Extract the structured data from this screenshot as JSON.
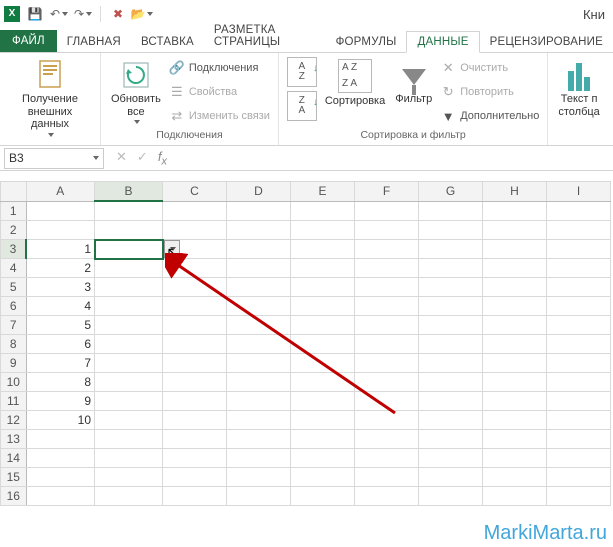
{
  "qat": {
    "book_title": "Кни",
    "icons": {
      "save": "💾",
      "undo": "↶",
      "redo": "↷",
      "remove": "✖",
      "open": "📂"
    }
  },
  "tabs": {
    "file": "ФАЙЛ",
    "home": "ГЛАВНАЯ",
    "insert": "ВСТАВКА",
    "page_layout": "РАЗМЕТКА СТРАНИЦЫ",
    "formulas": "ФОРМУЛЫ",
    "data": "ДАННЫЕ",
    "review": "РЕЦЕНЗИРОВАНИЕ"
  },
  "ribbon": {
    "get_data": {
      "label": "Получение\nвнешних данных"
    },
    "connections": {
      "refresh": "Обновить\nвсе",
      "conn": "Подключения",
      "props": "Свойства",
      "edit_links": "Изменить связи",
      "group_label": "Подключения"
    },
    "sort_filter": {
      "sort": "Сортировка",
      "filter": "Фильтр",
      "clear": "Очистить",
      "reapply": "Повторить",
      "advanced": "Дополнительно",
      "group_label": "Сортировка и фильтр"
    },
    "text": {
      "text_to_cols": "Текст п\nстолбца"
    }
  },
  "name_box": "B3",
  "columns": [
    "A",
    "B",
    "C",
    "D",
    "E",
    "F",
    "G",
    "H",
    "I"
  ],
  "rows": [
    "1",
    "2",
    "3",
    "4",
    "5",
    "6",
    "7",
    "8",
    "9",
    "10",
    "11",
    "12",
    "13",
    "14",
    "15",
    "16"
  ],
  "cell_values": {
    "A3": "1",
    "A4": "2",
    "A5": "3",
    "A6": "4",
    "A7": "5",
    "A8": "6",
    "A9": "7",
    "A10": "8",
    "A11": "9",
    "A12": "10"
  },
  "watermark": "MarkiMarta.ru",
  "chart_data": {
    "type": "table",
    "columns": [
      "A"
    ],
    "rows": [
      1,
      2,
      3,
      4,
      5,
      6,
      7,
      8,
      9,
      10
    ],
    "note": "Column A in rows 3–12 contains integers 1 through 10; active cell is B3 with a data-validation dropdown."
  }
}
